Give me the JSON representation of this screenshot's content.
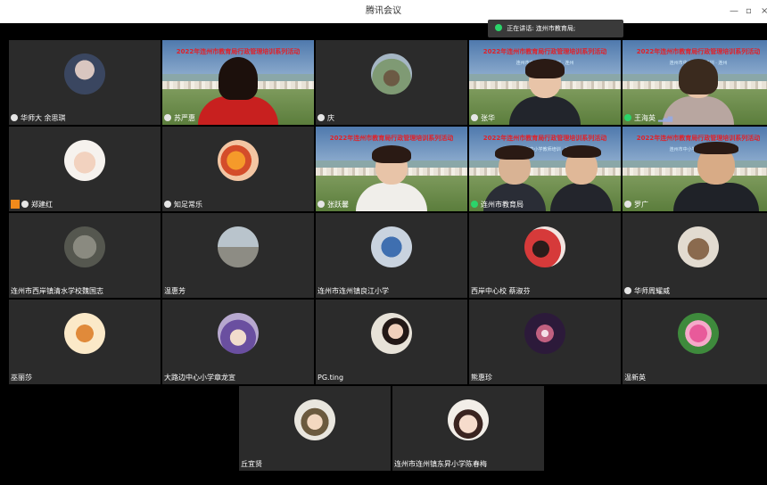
{
  "window": {
    "title": "腾讯会议",
    "controls": [
      "—",
      "▫",
      "×"
    ]
  },
  "speaking": {
    "label": "正在讲话: 连州市教育局;"
  },
  "banner": {
    "line1": "2022年连州市教育局行政管理培训系列活动",
    "line2": "连州市中小学教师培训 · 连州"
  },
  "colors": {
    "tile_bg": "#2b2b2b",
    "active_mic": "#2bd46a",
    "banner_red": "#e0222a"
  },
  "tiles": {
    "r1c1": "华师大 余思琪",
    "r1c2": "苏严惠",
    "r1c3": "庆",
    "r1c4": "张华",
    "r1c5": "王海英",
    "r2c1": "郑建红",
    "r2c2": "知足常乐",
    "r2c3": "张跃馨",
    "r2c4": "连州市教育局",
    "r2c5": "罗广",
    "r3c1": "连州市西岸镇清水学校魏国志",
    "r3c2": "温惠芳",
    "r3c3": "连州市连州镇良江小学",
    "r3c4": "西岸中心校 蔡淑芬",
    "r3c5": "华师周耀威",
    "r4c1": "巫丽莎",
    "r4c2": "大路边中心小学章龙宣",
    "r4c3": "PG.ting",
    "r4c4": "熊惠珍",
    "r4c5": "温新英",
    "r5c1": "丘宜贤",
    "r5c2": "连州市连州镇东昇小学陈春梅"
  }
}
